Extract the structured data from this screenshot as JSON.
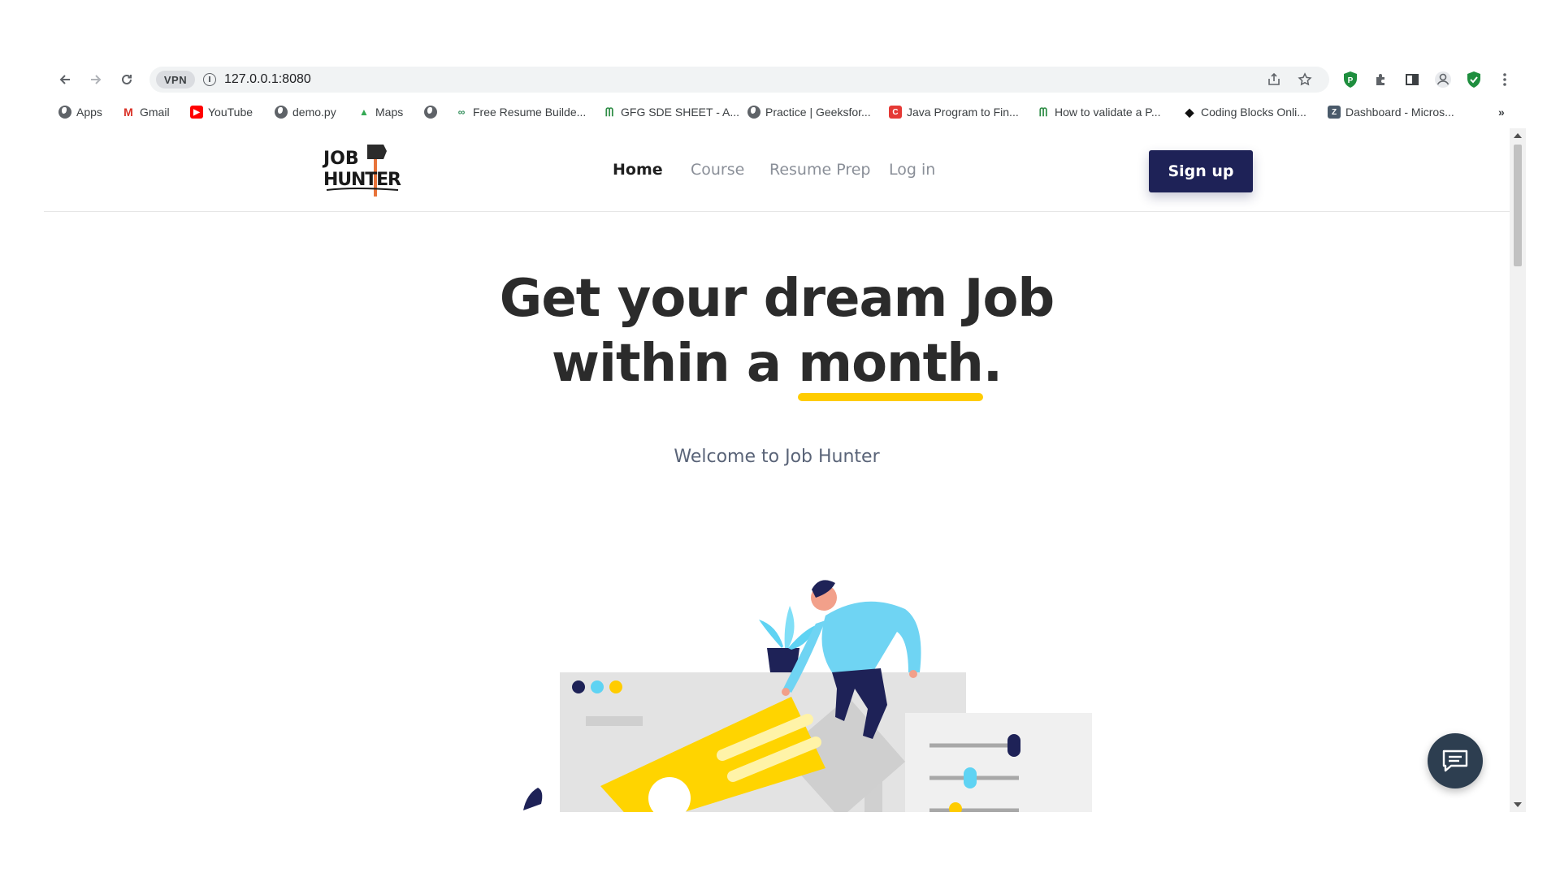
{
  "browser": {
    "url": "127.0.0.1:8080",
    "vpn_label": "VPN",
    "bookmarks": [
      {
        "label": "Apps",
        "icon": "globe-icon"
      },
      {
        "label": "Gmail",
        "icon": "gmail-icon"
      },
      {
        "label": "YouTube",
        "icon": "youtube-icon"
      },
      {
        "label": "demo.py",
        "icon": "globe-icon"
      },
      {
        "label": "Maps",
        "icon": "maps-icon"
      },
      {
        "label": "",
        "icon": "globe-icon"
      },
      {
        "label": "Free Resume Builde...",
        "icon": "resume-icon"
      },
      {
        "label": "GFG SDE SHEET - A...",
        "icon": "gfg-icon"
      },
      {
        "label": "Practice | Geeksfor...",
        "icon": "globe-icon"
      },
      {
        "label": "Java Program to Fin...",
        "icon": "c-icon"
      },
      {
        "label": "How to validate a P...",
        "icon": "gfg-icon"
      },
      {
        "label": "Coding Blocks Onli...",
        "icon": "coding-blocks-icon"
      },
      {
        "label": "Dashboard - Micros...",
        "icon": "dashboard-icon"
      }
    ],
    "overflow_label": "»"
  },
  "site": {
    "logo_line1": "JOB",
    "logo_line2": "HUNTER",
    "nav": [
      {
        "label": "Home",
        "active": true
      },
      {
        "label": "Course",
        "active": false
      },
      {
        "label": "Resume Prep",
        "active": false
      },
      {
        "label": "Log in",
        "active": false
      }
    ],
    "signup_label": "Sign up",
    "hero_line1": "Get your dream Job",
    "hero_line2_prefix": "within a ",
    "hero_line2_highlight": "month",
    "hero_line2_suffix": ".",
    "welcome": "Welcome to Job Hunter"
  },
  "colors": {
    "primary": "#1e2257",
    "highlight": "#ffcc00",
    "accent_blue": "#5fd3f3",
    "chat_fab": "#2d3e50"
  }
}
